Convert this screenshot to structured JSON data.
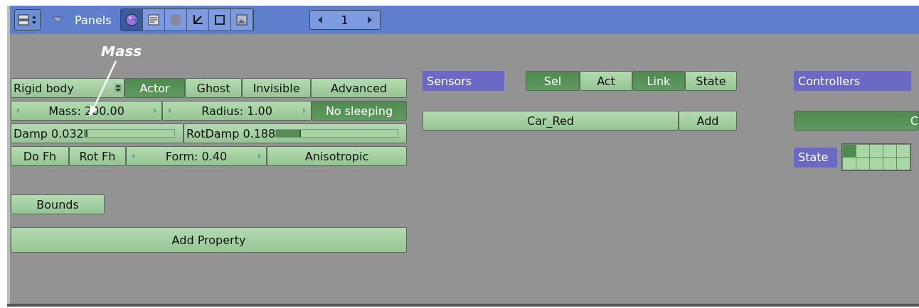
{
  "header": {
    "panels_label": "Panels",
    "tabs": [
      {
        "selected": true
      },
      {
        "selected": false
      },
      {
        "selected": false
      },
      {
        "selected": false
      },
      {
        "selected": false
      },
      {
        "selected": false
      }
    ],
    "frame_field": {
      "value": "1"
    }
  },
  "annotation": {
    "label": "Mass"
  },
  "physics": {
    "type": {
      "value": "Rigid body"
    },
    "toggles": [
      {
        "label": "Actor",
        "on": true
      },
      {
        "label": "Ghost",
        "on": false
      },
      {
        "label": "Invisible",
        "on": false
      },
      {
        "label": "Advanced",
        "on": false
      }
    ],
    "mass": {
      "value": "Mass: 200.00"
    },
    "radius": {
      "value": "Radius: 1.00"
    },
    "no_sleeping": {
      "label": "No sleeping",
      "on": true
    },
    "sliders": [
      {
        "label": "Damp 0.032",
        "level": 0.02
      },
      {
        "label": "RotDamp 0.188",
        "level": 0.19
      }
    ],
    "row4": [
      {
        "kind": "toggle",
        "label": "Do Fh",
        "on": false
      },
      {
        "kind": "toggle",
        "label": "Rot Fh",
        "on": false
      },
      {
        "kind": "number",
        "label": "Form: 0.40"
      },
      {
        "kind": "toggle",
        "label": "Anisotropic",
        "on": false
      }
    ],
    "bounds": {
      "label": "Bounds"
    },
    "add_property": {
      "label": "Add Property"
    }
  },
  "sensors": {
    "title": "Sensors",
    "filters": [
      {
        "label": "Sel",
        "on": true
      },
      {
        "label": "Act",
        "on": false
      },
      {
        "label": "Link",
        "on": true
      },
      {
        "label": "State",
        "on": false
      }
    ],
    "object": {
      "label": "Car_Red"
    },
    "add": {
      "label": "Add"
    }
  },
  "controllers": {
    "title": "Controllers",
    "object": {
      "label": "C"
    },
    "state_label": "State",
    "state_bits": [
      {
        "on": true
      },
      {
        "on": false
      },
      {
        "on": false
      },
      {
        "on": false
      },
      {
        "on": false
      },
      {
        "on": false
      },
      {
        "on": false
      },
      {
        "on": false
      },
      {
        "on": false
      },
      {
        "on": false
      }
    ]
  }
}
